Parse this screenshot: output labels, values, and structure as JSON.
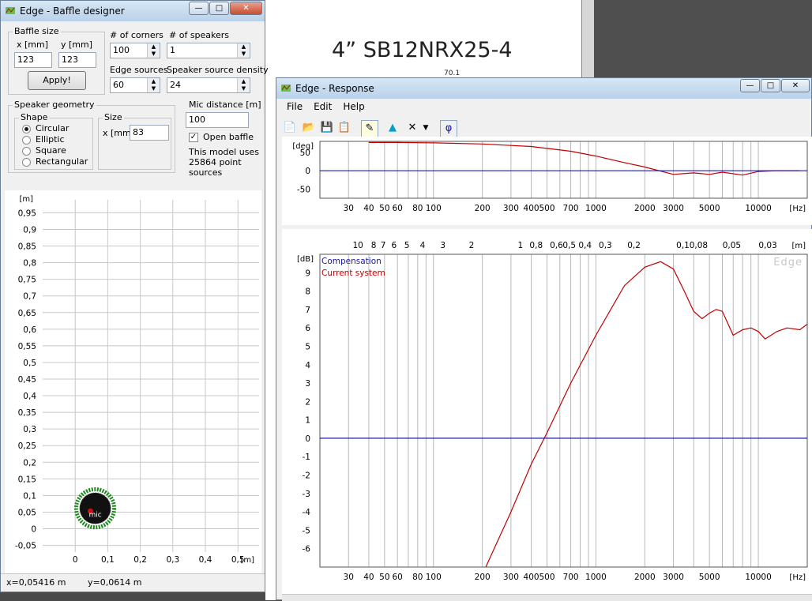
{
  "background_doc": {
    "title": "4” SB12NRX25-4",
    "small_number": "70.1"
  },
  "baffle_window": {
    "title": "Edge - Baffle designer",
    "baffle_size_legend": "Baffle size",
    "x_label": "x [mm]",
    "y_label": "y [mm]",
    "x_value": "123",
    "y_value": "123",
    "apply_label": "Apply!",
    "corners_label": "# of corners",
    "corners_value": "100",
    "speakers_label": "# of speakers",
    "speakers_value": "1",
    "edge_sources_label": "Edge sources",
    "edge_sources_value": "60",
    "density_label": "Speaker source density",
    "density_value": "24",
    "geometry_legend": "Speaker geometry",
    "shape_legend": "Shape",
    "shapes": [
      "Circular",
      "Elliptic",
      "Square",
      "Rectangular"
    ],
    "selected_shape": "Circular",
    "size_legend": "Size",
    "size_label": "x [mm]",
    "size_value": "83",
    "mic_label": "Mic distance [m]",
    "mic_value": "100",
    "open_baffle_label": "Open baffle",
    "open_baffle_checked": true,
    "model_info": [
      "This model uses",
      "25864 point",
      "sources"
    ],
    "status_x": "x=0,05416 m",
    "status_y": "y=0,0614 m",
    "plot": {
      "y_unit": "[m]",
      "x_unit": "[m]",
      "y_ticks": [
        "0,95",
        "0,9",
        "0,85",
        "0,8",
        "0,75",
        "0,7",
        "0,65",
        "0,6",
        "0,55",
        "0,5",
        "0,45",
        "0,4",
        "0,35",
        "0,3",
        "0,25",
        "0,2",
        "0,15",
        "0,1",
        "0,05",
        "0",
        "-0,05"
      ],
      "x_ticks": [
        "0",
        "0,1",
        "0,2",
        "0,3",
        "0,4",
        "0,5"
      ],
      "mic_label": "mic",
      "speaker_color": "#1e8a1e",
      "speaker_fill": "#111111"
    }
  },
  "response_window": {
    "title": "Edge - Response",
    "menu": [
      "File",
      "Edit",
      "Help"
    ],
    "toolbar_icons": [
      "new-icon",
      "open-icon",
      "save-icon",
      "copy-icon",
      "pen-icon",
      "shape-icon",
      "delete-icon",
      "dropdown-icon",
      "phi-icon"
    ],
    "phi_symbol": "φ",
    "phase_plot": {
      "y_unit": "[deg]",
      "y_ticks": [
        "50",
        "0",
        "-50"
      ],
      "x_unit": "[Hz]",
      "x_ticks": [
        "30",
        "40",
        "50",
        "60",
        "80",
        "100",
        "200",
        "300",
        "400",
        "500",
        "700",
        "1000",
        "2000",
        "3000",
        "5000",
        "10000"
      ]
    },
    "mag_plot": {
      "y_unit": "[dB]",
      "y_ticks": [
        "9",
        "8",
        "7",
        "6",
        "5",
        "4",
        "3",
        "2",
        "1",
        "0",
        "-1",
        "-2",
        "-3",
        "-4",
        "-5",
        "-6"
      ],
      "x_unit": "[Hz]",
      "x_ticks": [
        "30",
        "40",
        "50",
        "60",
        "80",
        "100",
        "200",
        "300",
        "400",
        "500",
        "700",
        "1000",
        "2000",
        "3000",
        "5000",
        "10000"
      ],
      "top_unit": "[m]",
      "top_ticks": [
        "10",
        "8",
        "7",
        "6",
        "5",
        "4",
        "3",
        "2",
        "1",
        "0,8",
        "0,6",
        "0,5",
        "0,4",
        "0,3",
        "0,2",
        "0,1",
        "0,08",
        "0,05",
        "0,03"
      ],
      "legend": [
        "Compensation",
        "Current system"
      ],
      "legend_colors": [
        "#1a1aa0",
        "#c00000"
      ],
      "watermark": "Edge"
    }
  },
  "chart_data": [
    {
      "type": "line",
      "title": "",
      "xlabel": "[Hz]",
      "ylabel": "[deg]",
      "x_scale": "log",
      "xlim": [
        20,
        20000
      ],
      "ylim": [
        -75,
        80
      ],
      "series": [
        {
          "name": "",
          "color": "#c00000",
          "x": [
            40,
            60,
            100,
            200,
            400,
            700,
            1000,
            1500,
            2000,
            3000,
            4000,
            5000,
            6000,
            8000,
            10000,
            13000,
            18000
          ],
          "y": [
            77,
            77,
            76,
            73,
            66,
            53,
            40,
            22,
            10,
            -10,
            -6,
            -10,
            -4,
            -12,
            -2,
            0,
            0
          ]
        },
        {
          "name": "",
          "color": "#1a1aa0",
          "x": [
            20,
            20000
          ],
          "y": [
            0,
            0
          ]
        }
      ]
    },
    {
      "type": "line",
      "title": "",
      "xlabel": "[Hz]",
      "ylabel": "[dB]",
      "x_scale": "log",
      "xlim": [
        20,
        20000
      ],
      "ylim": [
        -7,
        10
      ],
      "series": [
        {
          "name": "Current system",
          "color": "#c00000",
          "x": [
            210,
            300,
            400,
            500,
            700,
            1000,
            1500,
            2000,
            2500,
            3000,
            3500,
            4000,
            4500,
            5000,
            5500,
            6000,
            7000,
            8000,
            9000,
            10000,
            11000,
            13000,
            15000,
            18000,
            20000
          ],
          "y": [
            -7,
            -4,
            -1.4,
            0.3,
            3,
            5.6,
            8.3,
            9.3,
            9.6,
            9.2,
            8,
            6.9,
            6.5,
            6.8,
            7,
            6.9,
            5.6,
            5.9,
            6,
            5.8,
            5.4,
            5.8,
            6,
            5.9,
            6.2
          ]
        },
        {
          "name": "Compensation",
          "color": "#1a1aa0",
          "x": [
            20,
            20000
          ],
          "y": [
            0,
            0
          ]
        }
      ]
    }
  ]
}
